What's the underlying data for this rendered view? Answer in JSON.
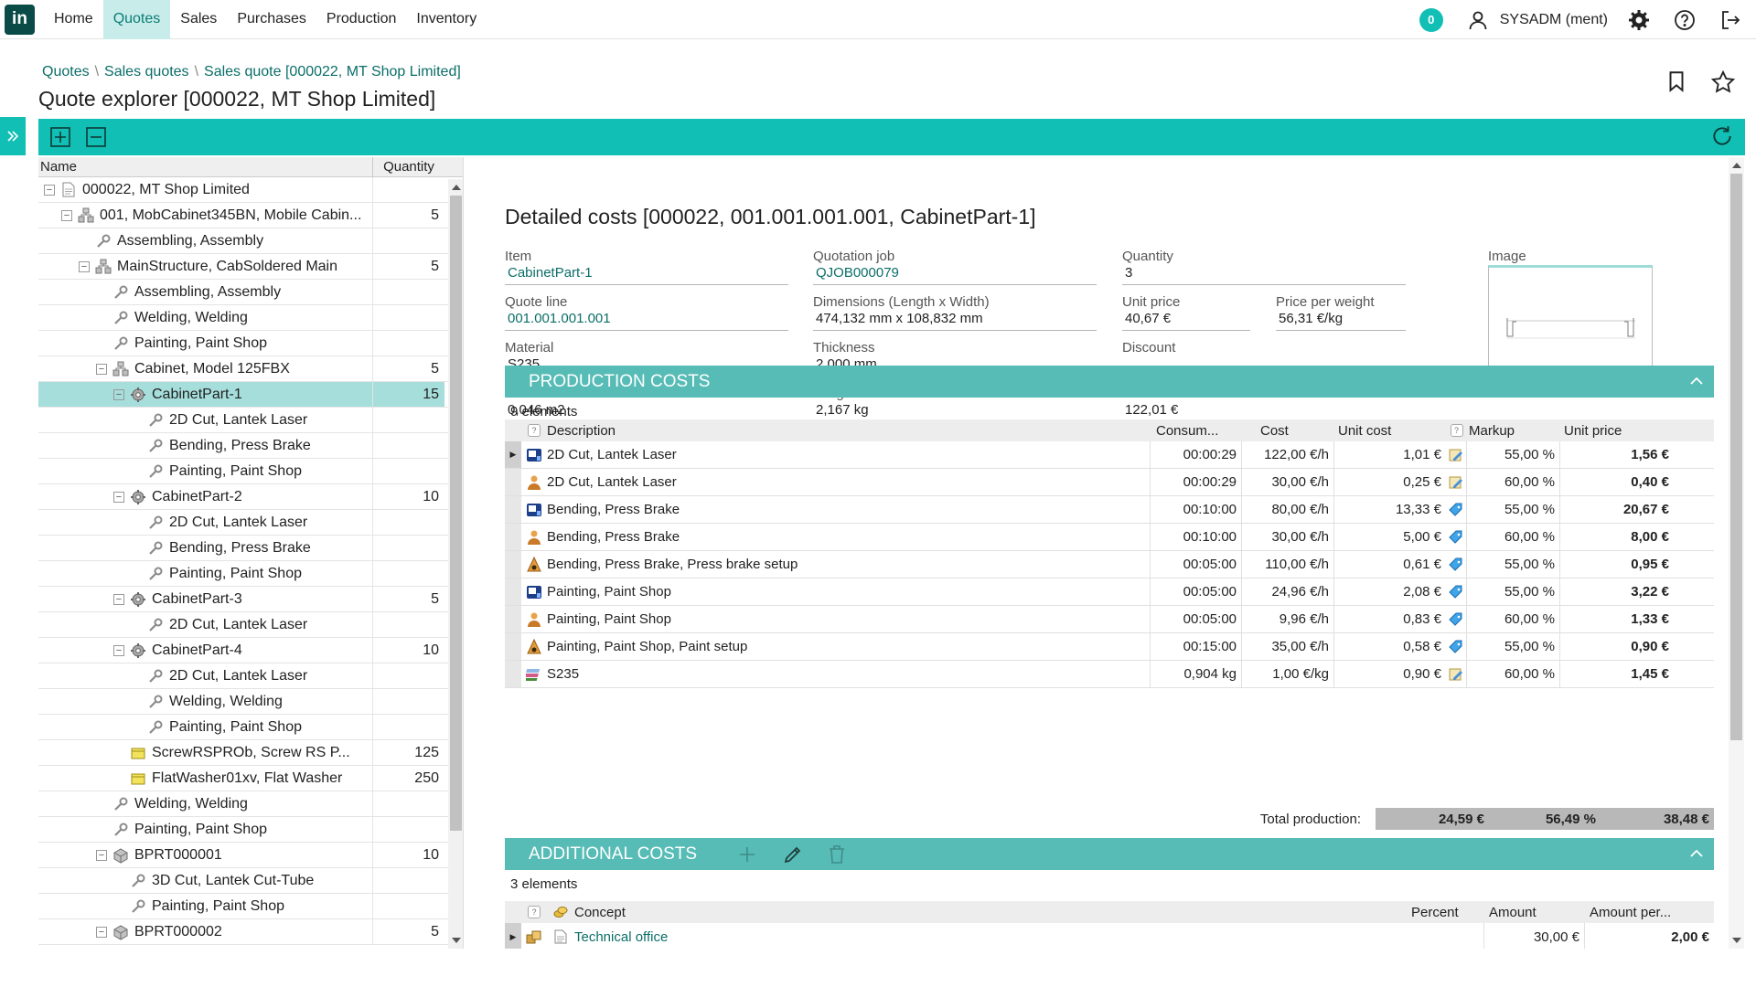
{
  "app": {
    "logo_text": "in",
    "nav": [
      "Home",
      "Quotes",
      "Sales",
      "Purchases",
      "Production",
      "Inventory"
    ],
    "active_nav": "Quotes",
    "notifications": "0",
    "user": "SYSADM (ment)",
    "accent": "#12bfb4"
  },
  "breadcrumb": [
    "Quotes",
    "Sales quotes",
    "Sales quote [000022, MT Shop Limited]"
  ],
  "page_title": "Quote explorer [000022, MT Shop Limited]",
  "tree": {
    "columns": {
      "name": "Name",
      "quantity": "Quantity"
    },
    "rows": [
      {
        "level": 0,
        "exp": "-",
        "icon": "document-icon",
        "name": "000022, MT Shop Limited",
        "qty": ""
      },
      {
        "level": 1,
        "exp": "-",
        "icon": "assembly-icon",
        "name": "001, MobCabinet345BN, Mobile Cabin...",
        "qty": "5"
      },
      {
        "level": 2,
        "exp": "",
        "icon": "wrench-icon",
        "name": "Assembling, Assembly",
        "qty": ""
      },
      {
        "level": 2,
        "exp": "-",
        "icon": "assembly-icon",
        "name": "MainStructure, CabSoldered Main",
        "qty": "5"
      },
      {
        "level": 3,
        "exp": "",
        "icon": "wrench-icon",
        "name": "Assembling, Assembly",
        "qty": ""
      },
      {
        "level": 3,
        "exp": "",
        "icon": "wrench-icon",
        "name": "Welding, Welding",
        "qty": ""
      },
      {
        "level": 3,
        "exp": "",
        "icon": "wrench-icon",
        "name": "Painting, Paint Shop",
        "qty": ""
      },
      {
        "level": 3,
        "exp": "-",
        "icon": "assembly-icon",
        "name": "Cabinet, Model 125FBX",
        "qty": "5"
      },
      {
        "level": 4,
        "exp": "-",
        "icon": "gear-icon",
        "name": "CabinetPart-1",
        "qty": "15",
        "selected": true
      },
      {
        "level": 5,
        "exp": "",
        "icon": "wrench-icon",
        "name": "2D Cut, Lantek Laser",
        "qty": ""
      },
      {
        "level": 5,
        "exp": "",
        "icon": "wrench-icon",
        "name": "Bending, Press Brake",
        "qty": ""
      },
      {
        "level": 5,
        "exp": "",
        "icon": "wrench-icon",
        "name": "Painting, Paint Shop",
        "qty": ""
      },
      {
        "level": 4,
        "exp": "-",
        "icon": "gear-icon",
        "name": "CabinetPart-2",
        "qty": "10"
      },
      {
        "level": 5,
        "exp": "",
        "icon": "wrench-icon",
        "name": "2D Cut, Lantek Laser",
        "qty": ""
      },
      {
        "level": 5,
        "exp": "",
        "icon": "wrench-icon",
        "name": "Bending, Press Brake",
        "qty": ""
      },
      {
        "level": 5,
        "exp": "",
        "icon": "wrench-icon",
        "name": "Painting, Paint Shop",
        "qty": ""
      },
      {
        "level": 4,
        "exp": "-",
        "icon": "gear-icon",
        "name": "CabinetPart-3",
        "qty": "5"
      },
      {
        "level": 5,
        "exp": "",
        "icon": "wrench-icon",
        "name": "2D Cut, Lantek Laser",
        "qty": ""
      },
      {
        "level": 4,
        "exp": "-",
        "icon": "gear-icon",
        "name": "CabinetPart-4",
        "qty": "10"
      },
      {
        "level": 5,
        "exp": "",
        "icon": "wrench-icon",
        "name": "2D Cut, Lantek Laser",
        "qty": ""
      },
      {
        "level": 5,
        "exp": "",
        "icon": "wrench-icon",
        "name": "Welding, Welding",
        "qty": ""
      },
      {
        "level": 5,
        "exp": "",
        "icon": "wrench-icon",
        "name": "Painting, Paint Shop",
        "qty": ""
      },
      {
        "level": 4,
        "exp": "",
        "icon": "box-icon",
        "name": "ScrewRSPROb, Screw RS P...",
        "qty": "125"
      },
      {
        "level": 4,
        "exp": "",
        "icon": "box-icon",
        "name": "FlatWasher01xv, Flat Washer",
        "qty": "250"
      },
      {
        "level": 3,
        "exp": "",
        "icon": "wrench-icon",
        "name": "Welding, Welding",
        "qty": ""
      },
      {
        "level": 3,
        "exp": "",
        "icon": "wrench-icon",
        "name": "Painting, Paint Shop",
        "qty": ""
      },
      {
        "level": 3,
        "exp": "-",
        "icon": "part-icon",
        "name": "BPRT000001",
        "qty": "10"
      },
      {
        "level": 4,
        "exp": "",
        "icon": "wrench-icon",
        "name": "3D Cut, Lantek Cut-Tube",
        "qty": ""
      },
      {
        "level": 4,
        "exp": "",
        "icon": "wrench-icon",
        "name": "Painting, Paint Shop",
        "qty": ""
      },
      {
        "level": 3,
        "exp": "-",
        "icon": "part-icon",
        "name": "BPRT000002",
        "qty": "5"
      }
    ]
  },
  "detail": {
    "title": "Detailed costs [000022, 001.001.001.001, CabinetPart-1]",
    "fields": {
      "item": {
        "label": "Item",
        "value": "CabinetPart-1"
      },
      "quotation_job": {
        "label": "Quotation job",
        "value": "QJOB000079"
      },
      "quantity": {
        "label": "Quantity",
        "value": "3"
      },
      "quote_line": {
        "label": "Quote line",
        "value": "001.001.001.001"
      },
      "dimensions": {
        "label": "Dimensions (Length x Width)",
        "value": "474,132 mm x 108,832 mm"
      },
      "unit_price": {
        "label": "Unit price",
        "value": "40,67 €"
      },
      "price_per_weight": {
        "label": "Price per weight",
        "value": "56,31 €/kg"
      },
      "material": {
        "label": "Material",
        "value": "S235"
      },
      "thickness": {
        "label": "Thickness",
        "value": "2,000 mm"
      },
      "discount": {
        "label": "Discount",
        "value": ""
      },
      "area": {
        "label": "Area",
        "value": "0,046 m2"
      },
      "weight": {
        "label": "Weight",
        "value": "2,167 kg"
      },
      "subtotal": {
        "label": "Subtotal",
        "value": "122,01 €"
      }
    },
    "image_label": "Image",
    "production": {
      "title": "PRODUCTION COSTS",
      "count": "9 elements",
      "columns": {
        "description": "Description",
        "consum": "Consum...",
        "cost": "Cost",
        "unit_cost": "Unit cost",
        "markup": "Markup",
        "unit_price": "Unit price"
      },
      "rows": [
        {
          "icon": "machine-icon",
          "desc": "2D Cut, Lantek Laser",
          "consum": "00:00:29",
          "cost": "122,00 €/h",
          "unit_cost": "1,01 €",
          "tag": "note-icon",
          "markup": "55,00 %",
          "unit_price": "1,56 €"
        },
        {
          "icon": "worker-icon",
          "desc": "2D Cut, Lantek Laser",
          "consum": "00:00:29",
          "cost": "30,00 €/h",
          "unit_cost": "0,25 €",
          "tag": "note-icon",
          "markup": "60,00 %",
          "unit_price": "0,40 €"
        },
        {
          "icon": "machine-icon",
          "desc": "Bending, Press Brake",
          "consum": "00:10:00",
          "cost": "80,00 €/h",
          "unit_cost": "13,33 €",
          "tag": "tag-icon",
          "markup": "55,00 %",
          "unit_price": "20,67 €"
        },
        {
          "icon": "worker-icon",
          "desc": "Bending, Press Brake",
          "consum": "00:10:00",
          "cost": "30,00 €/h",
          "unit_cost": "5,00 €",
          "tag": "tag-icon",
          "markup": "60,00 %",
          "unit_price": "8,00 €"
        },
        {
          "icon": "setup-icon",
          "desc": "Bending, Press Brake, Press brake setup",
          "consum": "00:05:00",
          "cost": "110,00 €/h",
          "unit_cost": "0,61 €",
          "tag": "tag-icon",
          "markup": "55,00 %",
          "unit_price": "0,95 €"
        },
        {
          "icon": "machine-icon",
          "desc": "Painting, Paint Shop",
          "consum": "00:05:00",
          "cost": "24,96 €/h",
          "unit_cost": "2,08 €",
          "tag": "tag-icon",
          "markup": "55,00 %",
          "unit_price": "3,22 €"
        },
        {
          "icon": "worker-icon",
          "desc": "Painting, Paint Shop",
          "consum": "00:05:00",
          "cost": "9,96 €/h",
          "unit_cost": "0,83 €",
          "tag": "tag-icon",
          "markup": "60,00 %",
          "unit_price": "1,33 €"
        },
        {
          "icon": "setup-icon",
          "desc": "Painting, Paint Shop, Paint setup",
          "consum": "00:15:00",
          "cost": "35,00 €/h",
          "unit_cost": "0,58 €",
          "tag": "tag-icon",
          "markup": "55,00 %",
          "unit_price": "0,90 €"
        },
        {
          "icon": "material-icon",
          "desc": "S235",
          "consum": "0,904 kg",
          "cost": "1,00 €/kg",
          "unit_cost": "0,90 €",
          "tag": "note-icon",
          "markup": "60,00 %",
          "unit_price": "1,45 €"
        }
      ],
      "total_label": "Total production:",
      "total_unit_cost": "24,59 €",
      "total_markup": "56,49 %",
      "total_unit_price": "38,48 €"
    },
    "additional": {
      "title": "ADDITIONAL COSTS",
      "count": "3 elements",
      "columns": {
        "concept": "Concept",
        "percent": "Percent",
        "amount": "Amount",
        "amount_per": "Amount per..."
      },
      "rows": [
        {
          "concept": "Technical office",
          "percent": "",
          "amount": "30,00 €",
          "amount_per": "2,00 €"
        }
      ]
    }
  }
}
